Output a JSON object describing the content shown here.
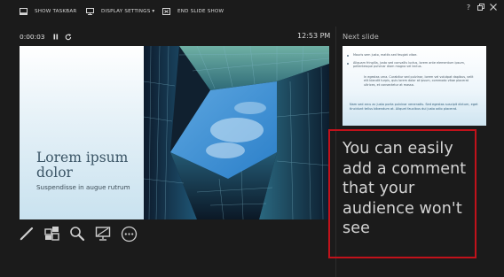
{
  "toolbar": {
    "show_taskbar": "SHOW TASKBAR",
    "display_settings": "DISPLAY SETTINGS ▾",
    "end_slide_show": "END SLIDE SHOW"
  },
  "window_controls": {
    "help_icon": "question-icon",
    "restore_icon": "restore-icon",
    "close_icon": "close-icon"
  },
  "timer": {
    "elapsed": "0:00:03",
    "pause_icon": "pause-icon",
    "restart_icon": "restart-icon"
  },
  "clock": "12:53 PM",
  "current_slide": {
    "title": "Lorem ipsum dolor",
    "subtitle": "Suspendisse in augue rutrum"
  },
  "tools": [
    "pen-icon",
    "slide-sorter-icon",
    "zoom-icon",
    "screen-icon",
    "more-options-icon"
  ],
  "next_slide": {
    "heading": "Next slide",
    "bullets": [
      {
        "text": "Mauris sem justo, mattis sed feugiat vitae.",
        "level": 1
      },
      {
        "text": "Aliquam fringilla, justo sed convallis luctus, lorem ante elementum ipsum, pellentesque pulvinar diam magna vel lectus.",
        "level": 1
      },
      {
        "text": "In egestas urna. Curabitur sed pulvinar, lorem vel volutpat dapibus, velit elit blandit turpis, quis lorem dolor at ipsum, commodo vitae placerat ultrices, et consectetur at massa.",
        "level": 2
      }
    ],
    "footer": "Nam sed arcu ac justo porta pulvinar venenatis. Sed egestas suscipit dictum, eget tincidunt tellus bibendum at. Aliquet faucibus dui justo odio placerat."
  },
  "notes": {
    "text": "You can easily add a comment that your audience won't see"
  },
  "colors": {
    "background": "#1b1b1b",
    "highlight_border": "#c1121b",
    "slide_text": "#3b5566"
  }
}
